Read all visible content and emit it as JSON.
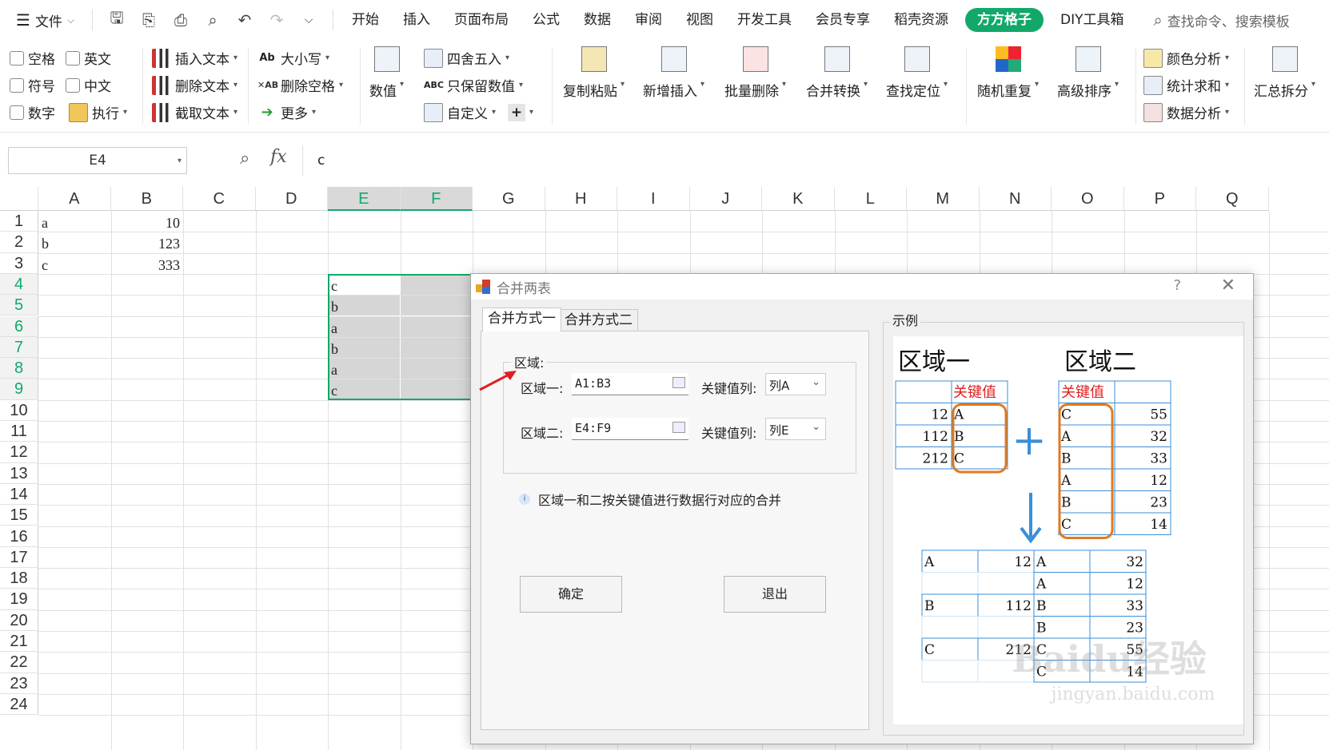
{
  "menubar": {
    "file_label": "文件",
    "tabs": [
      "开始",
      "插入",
      "页面布局",
      "公式",
      "数据",
      "审阅",
      "视图",
      "开发工具",
      "会员专享",
      "稻壳资源",
      "方方格子",
      "DIY工具箱"
    ],
    "highlighted_tab": "方方格子",
    "search_placeholder": "查找命令、搜索模板",
    "accent_color": "#12a86a"
  },
  "ribbon": {
    "checks": [
      "空格",
      "英文",
      "符号",
      "中文",
      "数字"
    ],
    "execute": "执行",
    "text_ops": [
      "插入文本",
      "删除文本",
      "截取文本"
    ],
    "case_ops": [
      "大小写",
      "删除空格",
      "更多"
    ],
    "value": "数值",
    "round_ops": [
      "四舍五入",
      "只保留数值",
      "自定义"
    ],
    "plus": "+",
    "big_buttons": [
      "复制粘贴",
      "新增插入",
      "批量删除",
      "合并转换",
      "查找定位",
      "随机重复",
      "高级排序"
    ],
    "analysis": [
      "颜色分析",
      "统计求和",
      "数据分析"
    ],
    "summary": "汇总拆分"
  },
  "formula_bar": {
    "name_box": "E4",
    "fx": "fx",
    "value": "c"
  },
  "grid": {
    "columns": [
      "A",
      "B",
      "C",
      "D",
      "E",
      "F",
      "G",
      "H",
      "I",
      "J",
      "K",
      "L",
      "M",
      "N",
      "O",
      "P",
      "Q"
    ],
    "rows": [
      "1",
      "2",
      "3",
      "4",
      "5",
      "6",
      "7",
      "8",
      "9",
      "10",
      "11",
      "12",
      "13",
      "14",
      "15",
      "16",
      "17",
      "18",
      "19",
      "20",
      "21",
      "22",
      "23",
      "24"
    ],
    "selected_columns": [
      "E",
      "F"
    ],
    "selected_rows": [
      "4",
      "5",
      "6",
      "7",
      "8",
      "9"
    ],
    "colA": [
      "a",
      "b",
      "c"
    ],
    "colB": [
      "10",
      "123",
      "333"
    ],
    "colE": [
      "c",
      "b",
      "a",
      "b",
      "a",
      "c"
    ]
  },
  "dialog": {
    "title": "合并两表",
    "help": "?",
    "close": "✕",
    "tab1": "合并方式一",
    "tab2": "合并方式二",
    "group_label": "区域:",
    "region1_label": "区域一:",
    "region1_value": "A1:B3",
    "key_label1": "关键值列:",
    "key1_value": "列A",
    "region2_label": "区域二:",
    "region2_value": "E4:F9",
    "key_label2": "关键值列:",
    "key2_value": "列E",
    "info_text": "区域一和二按关键值进行数据行对应的合并",
    "ok": "确定",
    "exit": "退出",
    "example_label": "示例"
  },
  "example": {
    "title1": "区域一",
    "title2": "区域二",
    "key_header": "关键值",
    "t1_rows": [
      [
        "12",
        "A"
      ],
      [
        "112",
        "B"
      ],
      [
        "212",
        "C"
      ]
    ],
    "t2_rows": [
      [
        "C",
        "55"
      ],
      [
        "A",
        "32"
      ],
      [
        "B",
        "33"
      ],
      [
        "A",
        "12"
      ],
      [
        "B",
        "23"
      ],
      [
        "C",
        "14"
      ]
    ],
    "result_rows": [
      [
        "A",
        "12",
        "A",
        "32"
      ],
      [
        "",
        "",
        "A",
        "12"
      ],
      [
        "B",
        "112",
        "B",
        "33"
      ],
      [
        "",
        "",
        "B",
        "23"
      ],
      [
        "C",
        "212",
        "C",
        "55"
      ],
      [
        "",
        "",
        "C",
        "14"
      ]
    ],
    "plus": "+",
    "watermark": "Baidu经验",
    "watermark_url": "jingyan.baidu.com"
  }
}
